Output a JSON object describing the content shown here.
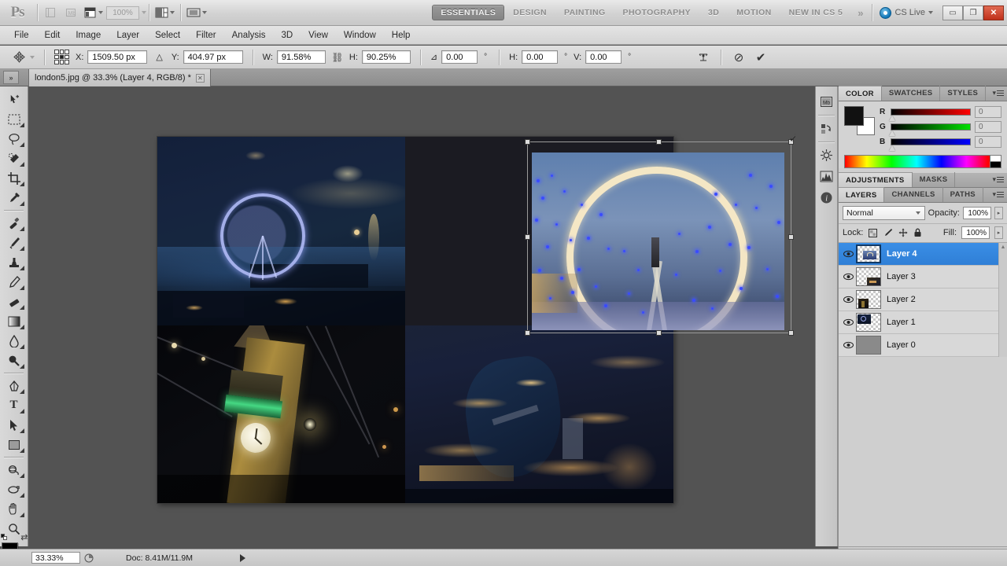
{
  "app": {
    "logo": "Ps",
    "window_controls": {
      "minimize": "▭",
      "restore": "❐",
      "close": "✕"
    },
    "cs_live": "CS Live",
    "zoom_field": "100%",
    "overflow": "»"
  },
  "workspaces": {
    "items": [
      {
        "label": "ESSENTIALS",
        "active": true
      },
      {
        "label": "DESIGN",
        "active": false
      },
      {
        "label": "PAINTING",
        "active": false
      },
      {
        "label": "PHOTOGRAPHY",
        "active": false
      },
      {
        "label": "3D",
        "active": false
      },
      {
        "label": "MOTION",
        "active": false
      },
      {
        "label": "NEW IN CS 5",
        "active": false
      }
    ]
  },
  "menubar": {
    "items": [
      "File",
      "Edit",
      "Image",
      "Layer",
      "Select",
      "Filter",
      "Analysis",
      "3D",
      "View",
      "Window",
      "Help"
    ]
  },
  "options_bar": {
    "tool": "move-tool",
    "x_label": "X:",
    "x_value": "1509.50 px",
    "delta_symbol": "△",
    "y_label": "Y:",
    "y_value": "404.97 px",
    "w_label": "W:",
    "w_value": "91.58%",
    "link_symbol": "⛓",
    "h_label": "H:",
    "h_value": "90.25%",
    "angle_label": "⊿",
    "angle_value": "0.00",
    "angle_unit": "°",
    "skew_h_label": "H:",
    "skew_h_value": "0.00",
    "skew_h_unit": "°",
    "skew_v_label": "V:",
    "skew_v_value": "0.00",
    "skew_v_unit": "°",
    "warp_icon": "warp-mode-icon",
    "cancel_icon": "⊘",
    "commit_icon": "✔"
  },
  "document": {
    "tab_title": "london5.jpg @ 33.3% (Layer 4, RGB/8) *",
    "close_glyph": "✕",
    "dock_expand": "»"
  },
  "tools": [
    {
      "name": "move-tool",
      "has_flyout": false
    },
    {
      "name": "rectangular-marquee-tool",
      "has_flyout": true
    },
    {
      "name": "lasso-tool",
      "has_flyout": true
    },
    {
      "name": "quick-selection-tool",
      "has_flyout": true
    },
    {
      "name": "crop-tool",
      "has_flyout": true
    },
    {
      "name": "eyedropper-tool",
      "has_flyout": true
    },
    {
      "name": "spot-healing-brush-tool",
      "has_flyout": true
    },
    {
      "name": "brush-tool",
      "has_flyout": true
    },
    {
      "name": "clone-stamp-tool",
      "has_flyout": true
    },
    {
      "name": "history-brush-tool",
      "has_flyout": true
    },
    {
      "name": "eraser-tool",
      "has_flyout": true
    },
    {
      "name": "gradient-tool",
      "has_flyout": true
    },
    {
      "name": "blur-tool",
      "has_flyout": true
    },
    {
      "name": "dodge-tool",
      "has_flyout": true
    },
    {
      "name": "pen-tool",
      "has_flyout": true
    },
    {
      "name": "horizontal-type-tool",
      "has_flyout": true
    },
    {
      "name": "path-selection-tool",
      "has_flyout": true
    },
    {
      "name": "rectangle-tool",
      "has_flyout": true
    },
    {
      "name": "3d-object-rotate-tool",
      "has_flyout": true
    },
    {
      "name": "3d-camera-rotate-tool",
      "has_flyout": true
    },
    {
      "name": "hand-tool",
      "has_flyout": true
    },
    {
      "name": "zoom-tool",
      "has_flyout": false
    }
  ],
  "color_panel": {
    "tabs": [
      {
        "label": "COLOR",
        "active": true
      },
      {
        "label": "SWATCHES",
        "active": false
      },
      {
        "label": "STYLES",
        "active": false
      }
    ],
    "channels": [
      {
        "label": "R",
        "value": "0",
        "color": "#ff0000"
      },
      {
        "label": "G",
        "value": "0",
        "color": "#00ff00"
      },
      {
        "label": "B",
        "value": "0",
        "color": "#0000ff"
      }
    ],
    "foreground": "#000000",
    "background": "#ffffff"
  },
  "adjustments_panel": {
    "tabs": [
      {
        "label": "ADJUSTMENTS",
        "active": true
      },
      {
        "label": "MASKS",
        "active": false
      }
    ]
  },
  "layers_panel": {
    "tabs": [
      {
        "label": "LAYERS",
        "active": true
      },
      {
        "label": "CHANNELS",
        "active": false
      },
      {
        "label": "PATHS",
        "active": false
      }
    ],
    "blend_mode": "Normal",
    "opacity_label": "Opacity:",
    "opacity_value": "100%",
    "lock_label": "Lock:",
    "lock_icons": [
      "lock-transparent-pixels-icon",
      "lock-image-pixels-icon",
      "lock-position-icon",
      "lock-all-icon"
    ],
    "fill_label": "Fill:",
    "fill_value": "100%",
    "layers": [
      {
        "name": "Layer 4",
        "visible": true,
        "selected": true,
        "thumb": "london-eye-trees"
      },
      {
        "name": "Layer 3",
        "visible": true,
        "selected": false,
        "thumb": "aerial-city"
      },
      {
        "name": "Layer 2",
        "visible": true,
        "selected": false,
        "thumb": "big-ben"
      },
      {
        "name": "Layer 1",
        "visible": true,
        "selected": false,
        "thumb": "aerial-eye"
      },
      {
        "name": "Layer 0",
        "visible": true,
        "selected": false,
        "thumb": "gray-background"
      }
    ],
    "footer_icons": [
      "link-layers-icon",
      "layer-style-icon",
      "layer-mask-icon",
      "new-adjustment-layer-icon",
      "new-group-icon",
      "new-layer-icon",
      "delete-layer-icon"
    ]
  },
  "icon_rail": [
    "mini-bridge-icon",
    "history-icon",
    "adjustments-icon",
    "histogram-icon",
    "info-icon"
  ],
  "status_bar": {
    "zoom": "33.33%",
    "doc_label": "Doc: 8.41M/11.9M",
    "preview_icon": "preview-icon"
  },
  "canvas": {
    "quadrants": [
      {
        "name": "aerial-london-eye-thames",
        "position": "top-left"
      },
      {
        "name": "london-eye-blue-trees",
        "position": "top-right",
        "transforming": true
      },
      {
        "name": "big-ben-night",
        "position": "bottom-left"
      },
      {
        "name": "aerial-london-city-night",
        "position": "bottom-right"
      }
    ]
  }
}
